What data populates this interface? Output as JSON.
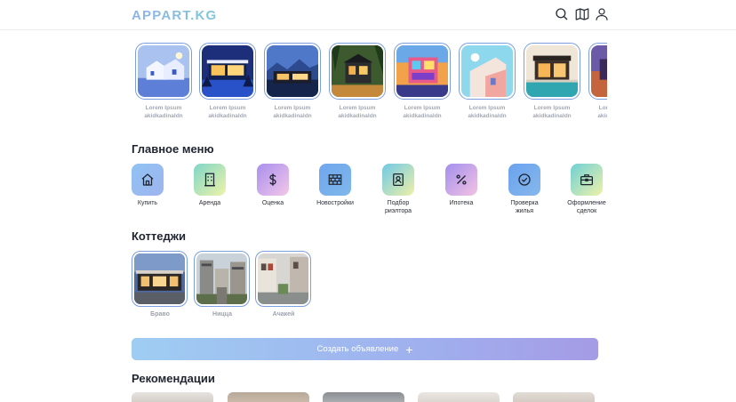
{
  "header": {
    "logo": "APPART.KG",
    "icons": [
      "search-icon",
      "map-icon",
      "user-icon"
    ]
  },
  "stories": [
    {
      "line1": "Lorem Ipsum",
      "line2": "akidkadinaldn"
    },
    {
      "line1": "Lorem Ipsum",
      "line2": "akidkadinaldn"
    },
    {
      "line1": "Lorem Ipsum",
      "line2": "akidkadinaldn"
    },
    {
      "line1": "Lorem Ipsum",
      "line2": "akidkadinaldn"
    },
    {
      "line1": "Lorem Ipsum",
      "line2": "akidkadinaldn"
    },
    {
      "line1": "Lorem Ipsum",
      "line2": "akidkadinaldn"
    },
    {
      "line1": "Lorem Ipsum",
      "line2": "akidkadinaldn"
    },
    {
      "line1": "Lorem Ipsum",
      "line2": "akidkadinaldn"
    }
  ],
  "main_menu": {
    "title": "Главное меню",
    "items": [
      {
        "line1": "Купить",
        "line2": "",
        "icon": "house-icon"
      },
      {
        "line1": "Аренда",
        "line2": "",
        "icon": "building-icon"
      },
      {
        "line1": "Оценка",
        "line2": "",
        "icon": "dollar-icon"
      },
      {
        "line1": "Новостройки",
        "line2": "",
        "icon": "brick-wall-icon"
      },
      {
        "line1": "Подбор",
        "line2": "риэлтора",
        "icon": "id-card-icon"
      },
      {
        "line1": "Ипотека",
        "line2": "",
        "icon": "percent-icon"
      },
      {
        "line1": "Проверка",
        "line2": "жилья",
        "icon": "check-circle-icon"
      },
      {
        "line1": "Оформление",
        "line2": "сделок",
        "icon": "briefcase-icon"
      }
    ]
  },
  "cottages": {
    "title": "Коттеджи",
    "items": [
      {
        "label": "Браво"
      },
      {
        "label": "Ницца"
      },
      {
        "label": "Ачакей"
      }
    ]
  },
  "create_button": {
    "label": "Создать объявление",
    "plus": "+"
  },
  "recommendations": {
    "title": "Рекомендации"
  }
}
